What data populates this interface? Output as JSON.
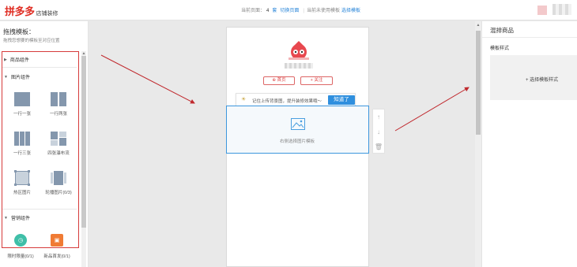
{
  "header": {
    "logo_main": "拼多多",
    "logo_sub": "店铺装修",
    "page_label": "当前页面：",
    "page_count": "4",
    "page_unit": "套",
    "switch_page": "切换页面",
    "unused_label": "当前未使用模板",
    "choose_template": "选择模板"
  },
  "left": {
    "title": "拖拽模板：",
    "subtitle": "拖拽您想要的模板至对应位置",
    "sections": {
      "goods": "商品组件",
      "image": "图片组件",
      "marketing": "营销组件"
    },
    "image_tiles": [
      "一行一张",
      "一行两张",
      "一行三张",
      "四张瀑布流",
      "热区图片",
      "轮播图片(0/3)"
    ],
    "marketing_tiles": [
      "限时限量(0/1)",
      "新品首发(0/1)"
    ]
  },
  "canvas": {
    "btn_home": "首页",
    "btn_follow": "+ 关注",
    "tip_text": "记住上传背景图，提升装修效果哦～",
    "tip_button": "知道了",
    "img_placeholder": "右侧选择图片模板"
  },
  "right": {
    "title": "混排商品",
    "sub": "模板样式",
    "choose_style": "+ 选择模板样式"
  },
  "colors": {
    "brand_red": "#e02e24",
    "accent_blue": "#2f8fde",
    "highlight_red": "#d63b3b"
  }
}
